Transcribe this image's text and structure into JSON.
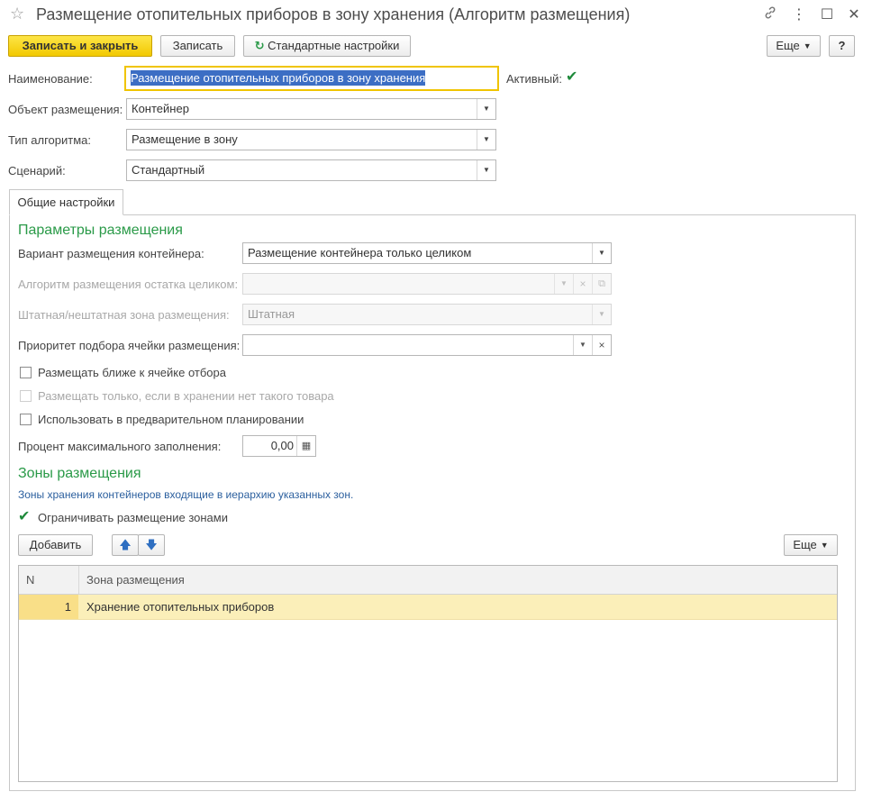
{
  "window": {
    "title": "Размещение отопительных приборов в зону хранения (Алгоритм размещения)"
  },
  "toolbar": {
    "save_close": "Записать и закрыть",
    "save": "Записать",
    "standard_settings": "Стандартные настройки",
    "more": "Еще",
    "help": "?"
  },
  "form": {
    "name_label": "Наименование:",
    "name_value": "Размещение отопительных приборов в зону хранения",
    "active_label": "Активный:",
    "active_checked": true,
    "object_label": "Объект размещения:",
    "object_value": "Контейнер",
    "algo_type_label": "Тип алгоритма:",
    "algo_type_value": "Размещение в зону",
    "scenario_label": "Сценарий:",
    "scenario_value": "Стандартный"
  },
  "tabs": [
    {
      "label": "Общие настройки",
      "active": true
    }
  ],
  "params": {
    "title": "Параметры размещения",
    "container_variant_label": "Вариант размещения контейнера:",
    "container_variant_value": "Размещение контейнера только целиком",
    "remainder_algo_label": "Алгоритм размещения остатка целиком:",
    "remainder_algo_value": "",
    "zone_type_label": "Штатная/нештатная зона размещения:",
    "zone_type_value": "Штатная",
    "cell_priority_label": "Приоритет подбора ячейки размещения:",
    "cell_priority_value": "",
    "cb_closer_label": "Размещать ближе к ячейке отбора",
    "cb_only_if_label": "Размещать только, если в хранении нет такого товара",
    "cb_prelim_label": "Использовать в предварительном планировании",
    "max_fill_label": "Процент максимального заполнения:",
    "max_fill_value": "0,00"
  },
  "zones": {
    "title": "Зоны размещения",
    "hint": "Зоны хранения контейнеров входящие в иерархию указанных зон.",
    "limit_label": "Ограничивать размещение зонами",
    "limit_checked": true,
    "add_button": "Добавить",
    "more_button": "Еще",
    "columns": [
      "N",
      "Зона размещения"
    ],
    "rows": [
      {
        "n": "1",
        "zone": "Хранение отопительных приборов"
      }
    ]
  },
  "colors": {
    "primary_button": "#f2c900",
    "group_title": "#2a9a48",
    "hint_text": "#2b5f9e",
    "selected_row": "#fbefb9"
  }
}
